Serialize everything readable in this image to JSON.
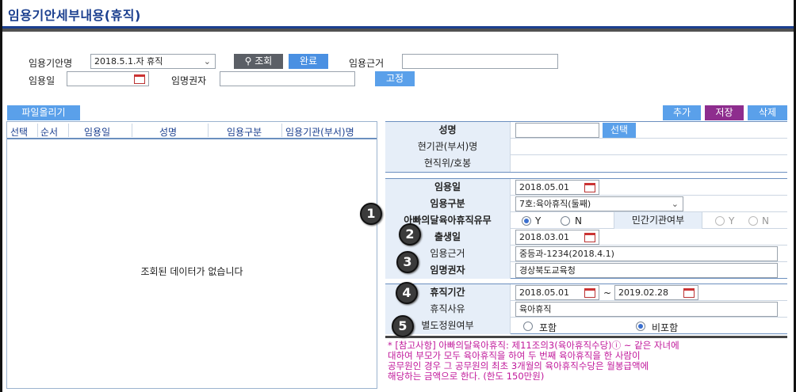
{
  "page": {
    "title": "임용기안세부내용(휴직)"
  },
  "search": {
    "draft_label": "임용기안명",
    "draft_value": "2018.5.1.자 휴직",
    "search_label": "조회",
    "done_label": "완료",
    "basis_label": "임용근거",
    "basis_value": "",
    "date_label": "임용일",
    "date_value": "",
    "appointer_label": "임명권자",
    "appointer_value": "",
    "fix_label": "고정"
  },
  "toolbar": {
    "upload_label": "파일올리기",
    "add_label": "추가",
    "save_label": "저장",
    "delete_label": "삭제"
  },
  "list": {
    "columns": [
      "선택",
      "순서",
      "임용일",
      "성명",
      "임용구분",
      "임용기관(부서)명"
    ],
    "empty_message": "조회된 데이터가 없습니다"
  },
  "form": {
    "name_label": "성명",
    "name_value": "",
    "select_label": "선택",
    "org_label": "현기관(부서)명",
    "org_value": "",
    "position_label": "현직위/호봉",
    "position_value": "",
    "appoint_date_label": "임용일",
    "appoint_date_value": "2018.05.01",
    "type_label": "임용구분",
    "type_value": "7호:육아휴직(둘째)",
    "father_label": "아빠의달육아휴직유무",
    "yes_label": "Y",
    "no_label": "N",
    "private_label": "민간기관여부",
    "birth_label": "출생일",
    "birth_value": "2018.03.01",
    "basis_label": "임용근거",
    "basis_value": "중등과-1234(2018.4.1)",
    "appointer_label": "임명권자",
    "appointer_value": "경상북도교육청",
    "leave_period_label": "휴직기간",
    "leave_start": "2018.05.01",
    "tilde": "~",
    "leave_end": "2019.02.28",
    "reason_label": "휴직사유",
    "reason_value": "육아휴직",
    "extra_label": "별도정원여부",
    "include_label": "포함",
    "exclude_label": "비포함"
  },
  "badges": [
    "1",
    "2",
    "3",
    "4",
    "5"
  ],
  "note": {
    "line1": "* [참고사항] 아빠의달육아휴직:  제11조의3(육아휴직수당)ⓘ ~ 같은 자녀에",
    "line2": "대하여 부모가 모두 육아휴직을 하여 두 번째 육아휴직을 한 사람이",
    "line3": "공무원인 경우 그 공무원의 최초 3개월의 육아휴직수당은 월봉급액에",
    "line4": "해당하는 금액으로 한다. (한도 150만원)"
  },
  "colors": {
    "title": "#1b3f8f",
    "accent_blue": "#4a90e2",
    "save_purple": "#8e2d8e",
    "note_magenta": "#c0179a"
  }
}
